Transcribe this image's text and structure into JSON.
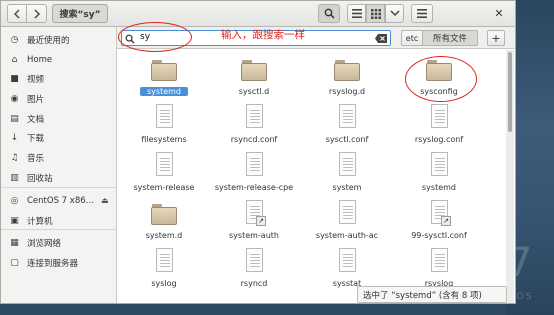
{
  "window": {
    "title": "搜索“sy”"
  },
  "toolbar": {
    "back_icon": "chevron-left-icon",
    "forward_icon": "chevron-right-icon",
    "path_label": "搜索“sy”",
    "close_glyph": "✕"
  },
  "sidebar": {
    "items": [
      {
        "label": "最近使用的",
        "icon": "clock-icon",
        "glyph": "◷"
      },
      {
        "label": "Home",
        "icon": "home-icon",
        "glyph": "⌂"
      },
      {
        "label": "视频",
        "icon": "video-icon",
        "glyph": "■"
      },
      {
        "label": "图片",
        "icon": "camera-icon",
        "glyph": "◉"
      },
      {
        "label": "文档",
        "icon": "document-icon",
        "glyph": "▤"
      },
      {
        "label": "下载",
        "icon": "download-icon",
        "glyph": "↓"
      },
      {
        "label": "音乐",
        "icon": "music-icon",
        "glyph": "♫"
      },
      {
        "label": "回收站",
        "icon": "trash-icon",
        "glyph": "▥"
      },
      {
        "label": "CentOS 7 x86…",
        "icon": "disc-icon",
        "glyph": "◎"
      },
      {
        "label": "计算机",
        "icon": "computer-icon",
        "glyph": "▣"
      },
      {
        "label": "浏览网络",
        "icon": "network-icon",
        "glyph": "▦"
      },
      {
        "label": "连接到服务器",
        "icon": "server-icon",
        "glyph": "▢"
      }
    ]
  },
  "search": {
    "value": "sy",
    "clear_icon": "clear-icon"
  },
  "scope": {
    "etc_label": "etc",
    "all_files_label": "所有文件",
    "add_label": "+"
  },
  "annotation": {
    "text": "输入，跟搜索一样"
  },
  "files": [
    {
      "name": "systemd",
      "type": "folder",
      "selected": true
    },
    {
      "name": "sysctl.d",
      "type": "folder"
    },
    {
      "name": "rsyslog.d",
      "type": "folder"
    },
    {
      "name": "sysconfig",
      "type": "folder",
      "circled": true
    },
    {
      "name": "filesystems",
      "type": "file"
    },
    {
      "name": "rsyncd.conf",
      "type": "file"
    },
    {
      "name": "sysctl.conf",
      "type": "file"
    },
    {
      "name": "rsyslog.conf",
      "type": "file"
    },
    {
      "name": "system-release",
      "type": "file"
    },
    {
      "name": "system-release-cpe",
      "type": "file"
    },
    {
      "name": "system",
      "type": "file"
    },
    {
      "name": "systemd",
      "type": "file"
    },
    {
      "name": "system.d",
      "type": "folder"
    },
    {
      "name": "system-auth",
      "type": "link"
    },
    {
      "name": "system-auth-ac",
      "type": "file"
    },
    {
      "name": "99-sysctl.conf",
      "type": "link"
    },
    {
      "name": "syslog",
      "type": "file"
    },
    {
      "name": "rsyncd",
      "type": "file"
    },
    {
      "name": "sysstat",
      "type": "file"
    },
    {
      "name": "rsyslog",
      "type": "file"
    }
  ],
  "status": {
    "text": "选中了 “systemd” (含有 8 项)"
  },
  "desktop": {
    "brand_glyph": "7",
    "brand_text": "TOS"
  },
  "colors": {
    "accent": "#4a90d9",
    "annotation": "#e0261c"
  }
}
